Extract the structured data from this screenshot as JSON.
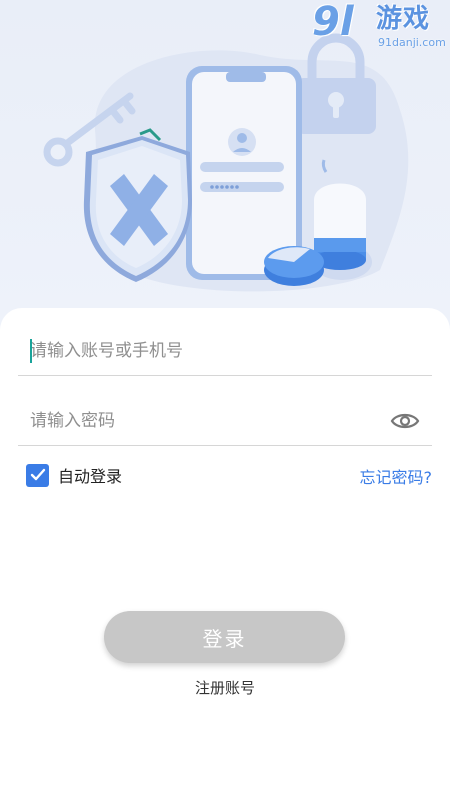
{
  "watermark": {
    "logo": "9l",
    "title": "游戏",
    "url": "91danji.com"
  },
  "login_form": {
    "account_placeholder": "请输入账号或手机号",
    "password_placeholder": "请输入密码",
    "account_value": "",
    "password_value": "",
    "remember_label": "自动登录",
    "remember_checked": true,
    "forgot_label": "忘记密码?",
    "login_label": "登录",
    "register_label": "注册账号"
  },
  "icons": {
    "password_toggle": "eye-icon",
    "checkbox": "check-icon"
  },
  "colors": {
    "accent": "#3a7ce6",
    "login_button_disabled": "#c7c7c7",
    "caret": "#1aa39a",
    "hero_background": "#e9eef8"
  }
}
